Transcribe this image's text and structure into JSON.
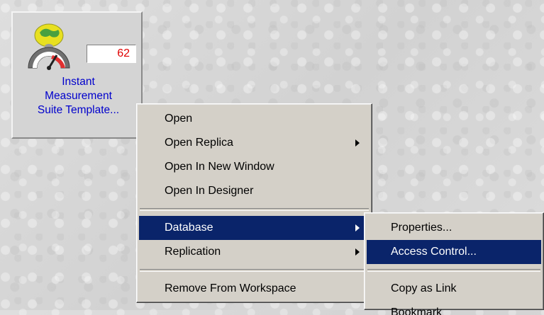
{
  "tile": {
    "count": "62",
    "title_lines": [
      "Instant",
      "Measurement",
      "Suite Template..."
    ],
    "icon": "speedometer-db-icon",
    "colors": {
      "title": "#0000cc",
      "count": "#e00000"
    }
  },
  "context_menu": {
    "items": [
      {
        "label": "Open"
      },
      {
        "label": "Open Replica"
      },
      {
        "label": "Open In New Window"
      },
      {
        "label": "Open In Designer"
      },
      {
        "label": "Database"
      },
      {
        "label": "Replication"
      },
      {
        "label": "Remove From Workspace"
      }
    ]
  },
  "database_submenu": {
    "items": [
      {
        "label": "Properties..."
      },
      {
        "label": "Access Control..."
      },
      {
        "label": "Copy as Link"
      },
      {
        "label": "Bookmark"
      }
    ]
  },
  "colors": {
    "highlight": "#0a246a",
    "menu_bg": "#d4d0c8"
  }
}
